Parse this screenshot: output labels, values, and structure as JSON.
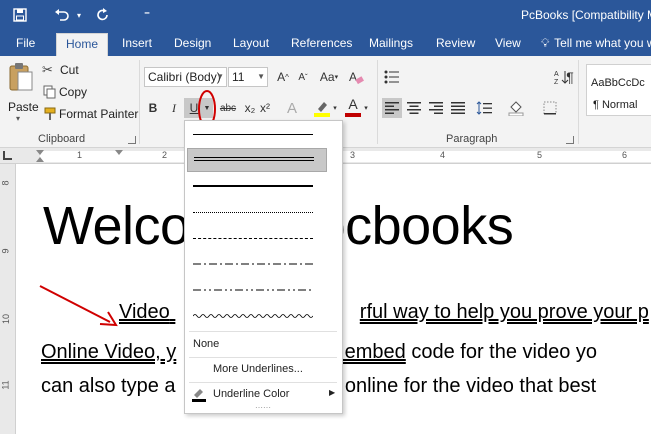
{
  "window": {
    "title": "PcBooks [Compatibility Mo"
  },
  "qat": {
    "more": "⁼"
  },
  "tabs": [
    {
      "label": "File",
      "active": false
    },
    {
      "label": "Home",
      "active": true
    },
    {
      "label": "Insert",
      "active": false
    },
    {
      "label": "Design",
      "active": false
    },
    {
      "label": "Layout",
      "active": false
    },
    {
      "label": "References",
      "active": false
    },
    {
      "label": "Mailings",
      "active": false
    },
    {
      "label": "Review",
      "active": false
    },
    {
      "label": "View",
      "active": false
    }
  ],
  "tell_me": "Tell me what you w",
  "clipboard": {
    "paste": "Paste",
    "cut": "Cut",
    "copy": "Copy",
    "format_painter": "Format Painter",
    "group_label": "Clipboard"
  },
  "font": {
    "name": "Calibri (Body)",
    "size": "11",
    "bold": "B",
    "italic": "I",
    "underline": "U",
    "strike": "abc",
    "subscript": "x₂",
    "superscript": "x²",
    "change_case": "Aa",
    "grow": "A",
    "shrink": "A",
    "text_effects": "A",
    "font_color": "A"
  },
  "paragraph": {
    "group_label": "Paragraph",
    "pilcrow": "¶"
  },
  "styles": {
    "preview": "AaBbCcDc",
    "name": "¶ Normal"
  },
  "ruler": {
    "marks": [
      "1",
      "2",
      "3",
      "4",
      "5",
      "6"
    ]
  },
  "vruler": {
    "marks": [
      "8",
      "9",
      "10",
      "11"
    ]
  },
  "document": {
    "heading_left": "Welco",
    "heading_right": "ocbooks",
    "p1_left": "Video",
    "p1_right": "rful way to help you prove your p",
    "p2_left": "Online Video, y",
    "p2_mid": "the embed",
    "p2_right": " code for the video yo",
    "p3_left": "can also type a",
    "p3_right": "rch online for the video that best"
  },
  "underline_menu": {
    "none": "None",
    "more": "More Underlines...",
    "color": "Underline Color",
    "grip": "⋯⋯"
  },
  "colors": {
    "brand": "#2b579a",
    "highlight_bar": "#ffff00",
    "font_color_bar": "#c00000",
    "annotation": "#d00000"
  }
}
